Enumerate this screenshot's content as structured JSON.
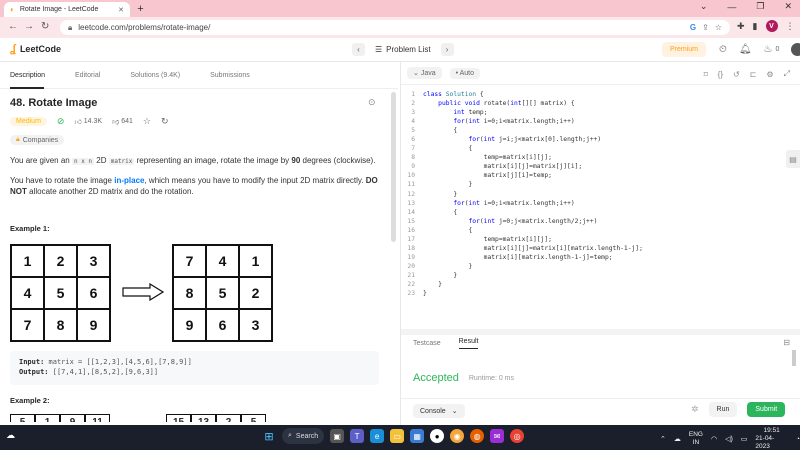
{
  "browser": {
    "tab_title": "Rotate Image - LeetCode",
    "new_tab": "+",
    "url": "leetcode.com/problems/rotate-image/",
    "window_controls": [
      "⌄",
      "—",
      "❐",
      "✕"
    ],
    "profile_initial": "V"
  },
  "header": {
    "logo_text": "LeetCode",
    "problem_list": "Problem List",
    "premium": "Premium",
    "streak_count": "0"
  },
  "left": {
    "tabs": [
      "Description",
      "Editorial",
      "Solutions (9.4K)",
      "Submissions"
    ],
    "title": "48. Rotate Image",
    "difficulty": "Medium",
    "likes": "14.3K",
    "dislikes": "641",
    "companies": "Companies",
    "desc1_a": "You are given an ",
    "desc1_code1": "n x n",
    "desc1_b": " 2D ",
    "desc1_code2": "matrix",
    "desc1_c": " representing an image, rotate the image by ",
    "desc1_bold": "90",
    "desc1_d": " degrees (clockwise).",
    "desc2_a": "You have to rotate the image ",
    "desc2_link": "in-place",
    "desc2_b": ", which means you have to modify the input 2D matrix directly. ",
    "desc2_bold": "DO NOT",
    "desc2_c": " allocate another 2D matrix and do the rotation.",
    "example1_label": "Example 1:",
    "matrix_in": [
      "1",
      "2",
      "3",
      "4",
      "5",
      "6",
      "7",
      "8",
      "9"
    ],
    "matrix_out": [
      "7",
      "4",
      "1",
      "8",
      "5",
      "2",
      "9",
      "6",
      "3"
    ],
    "input_label": "Input:",
    "input_value": " matrix = [[1,2,3],[4,5,6],[7,8,9]]",
    "output_label": "Output:",
    "output_value": " [[7,4,1],[8,5,2],[9,6,3]]",
    "example2_label": "Example 2:",
    "partial_in": [
      "5",
      "1",
      "9",
      "11"
    ],
    "partial_out": [
      "15",
      "13",
      "2",
      "5"
    ]
  },
  "editor": {
    "language": "Java",
    "autocomplete": "Auto",
    "lines": [
      [
        {
          "c": "kw",
          "t": "class "
        },
        {
          "c": "ty",
          "t": "Solution"
        },
        {
          "c": "tx",
          "t": " {"
        }
      ],
      [
        {
          "c": "tx",
          "t": "    "
        },
        {
          "c": "kw",
          "t": "public void "
        },
        {
          "c": "tx",
          "t": "rotate("
        },
        {
          "c": "kw",
          "t": "int"
        },
        {
          "c": "tx",
          "t": "[][] matrix) {"
        }
      ],
      [
        {
          "c": "tx",
          "t": "        "
        },
        {
          "c": "kw",
          "t": "int "
        },
        {
          "c": "tx",
          "t": "temp;"
        }
      ],
      [
        {
          "c": "tx",
          "t": "        "
        },
        {
          "c": "kw",
          "t": "for"
        },
        {
          "c": "tx",
          "t": "("
        },
        {
          "c": "kw",
          "t": "int "
        },
        {
          "c": "tx",
          "t": "i=0;i<matrix.length;i++)"
        }
      ],
      [
        {
          "c": "tx",
          "t": "        {"
        }
      ],
      [
        {
          "c": "tx",
          "t": "            "
        },
        {
          "c": "kw",
          "t": "for"
        },
        {
          "c": "tx",
          "t": "("
        },
        {
          "c": "kw",
          "t": "int "
        },
        {
          "c": "tx",
          "t": "j=i;j<matrix[0].length;j++)"
        }
      ],
      [
        {
          "c": "tx",
          "t": "            {"
        }
      ],
      [
        {
          "c": "tx",
          "t": "                temp=matrix[i][j];"
        }
      ],
      [
        {
          "c": "tx",
          "t": "                matrix[i][j]=matrix[j][i];"
        }
      ],
      [
        {
          "c": "tx",
          "t": "                matrix[j][i]=temp;"
        }
      ],
      [
        {
          "c": "tx",
          "t": "            }"
        }
      ],
      [
        {
          "c": "tx",
          "t": "        }"
        }
      ],
      [
        {
          "c": "tx",
          "t": "        "
        },
        {
          "c": "kw",
          "t": "for"
        },
        {
          "c": "tx",
          "t": "("
        },
        {
          "c": "kw",
          "t": "int "
        },
        {
          "c": "tx",
          "t": "i=0;i<matrix.length;i++)"
        }
      ],
      [
        {
          "c": "tx",
          "t": "        {"
        }
      ],
      [
        {
          "c": "tx",
          "t": "            "
        },
        {
          "c": "kw",
          "t": "for"
        },
        {
          "c": "tx",
          "t": "("
        },
        {
          "c": "kw",
          "t": "int "
        },
        {
          "c": "tx",
          "t": "j=0;j<matrix.length/2;j++)"
        }
      ],
      [
        {
          "c": "tx",
          "t": "            {"
        }
      ],
      [
        {
          "c": "tx",
          "t": "                temp=matrix[i][j];"
        }
      ],
      [
        {
          "c": "tx",
          "t": "                matrix[i][j]=matrix[i][matrix.length-1-j];"
        }
      ],
      [
        {
          "c": "tx",
          "t": "                matrix[i][matrix.length-1-j]=temp;"
        }
      ],
      [
        {
          "c": "tx",
          "t": "            }"
        }
      ],
      [
        {
          "c": "tx",
          "t": "        }"
        }
      ],
      [
        {
          "c": "tx",
          "t": "    }"
        }
      ],
      [
        {
          "c": "tx",
          "t": "}"
        }
      ]
    ]
  },
  "result": {
    "tabs": [
      "Testcase",
      "Result"
    ],
    "status": "Accepted",
    "runtime": "Runtime: 0 ms",
    "console": "Console",
    "run": "Run",
    "submit": "Submit"
  },
  "taskbar": {
    "search": "Search",
    "lang_1": "ENG",
    "lang_2": "IN",
    "time": "19:51",
    "date": "21-04-2023"
  },
  "colors": {
    "brand": "#ffa116",
    "accepted": "#2db55d",
    "keyword": "#0000ff",
    "type": "#267f99",
    "browser_frame": "#f7c6cf"
  }
}
